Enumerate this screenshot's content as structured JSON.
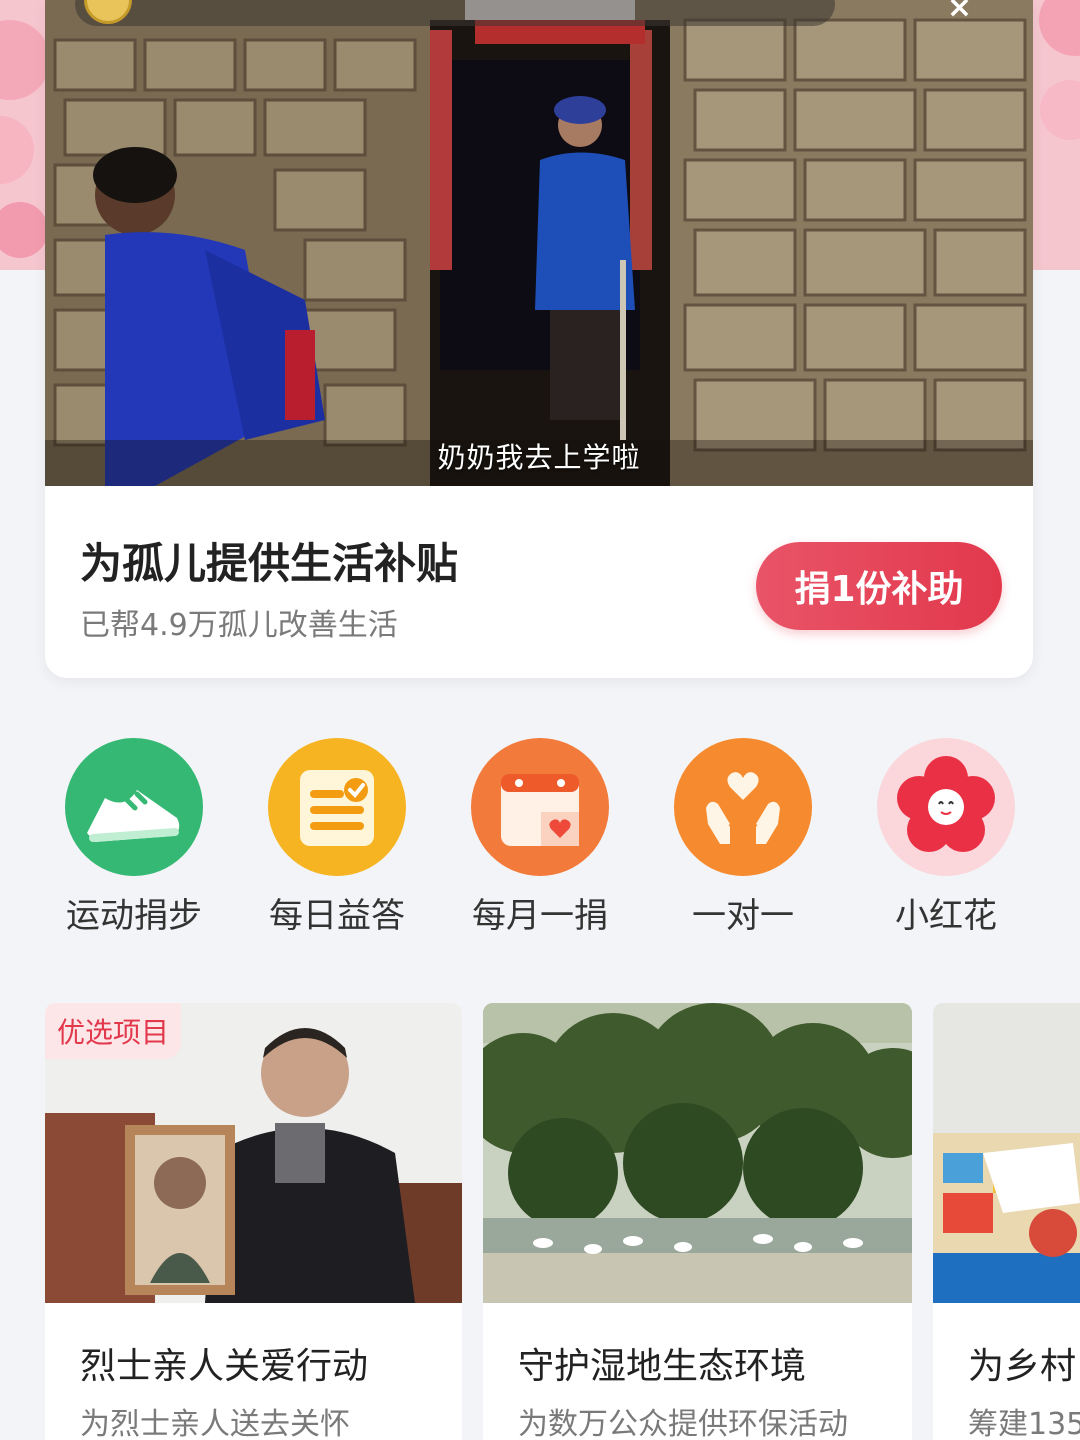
{
  "hero": {
    "subtitle": "奶奶我去上学啦",
    "title": "为孤儿提供生活补贴",
    "description": "已帮4.9万孤儿改善生活",
    "donate_label": "捐1份补助",
    "close_glyph": "×"
  },
  "quick_actions": [
    {
      "label": "运动捐步",
      "icon": "sneaker-icon",
      "color": "#35b873"
    },
    {
      "label": "每日益答",
      "icon": "checklist-icon",
      "color": "#f6b423"
    },
    {
      "label": "每月一捐",
      "icon": "calendar-heart-icon",
      "color": "#f27a3a"
    },
    {
      "label": "一对一",
      "icon": "hands-heart-icon",
      "color": "#f68a2e"
    },
    {
      "label": "小红花",
      "icon": "red-flower-icon",
      "color": "#ea4250"
    }
  ],
  "projects": [
    {
      "badge": "优选项目",
      "title": "烈士亲人关爱行动",
      "description": "为烈士亲人送去关怀"
    },
    {
      "title": "守护湿地生态环境",
      "description": "为数万公众提供环保活动"
    },
    {
      "title": "为乡村",
      "description": "筹建135"
    }
  ],
  "colors": {
    "accent": "#e2384c",
    "background": "#f3f4f7"
  }
}
